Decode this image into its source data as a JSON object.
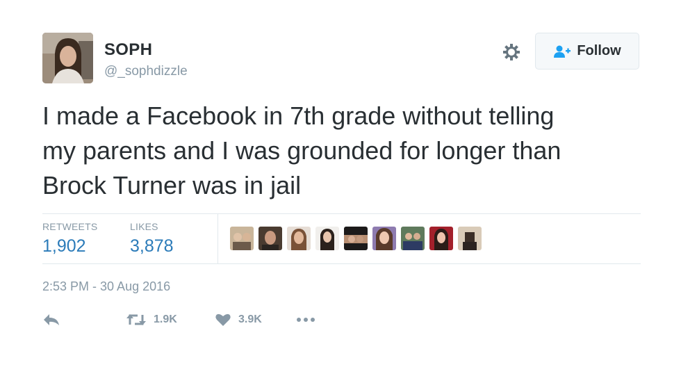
{
  "user": {
    "name": "SOPH",
    "handle": "@_sophdizzle"
  },
  "follow": {
    "label": "Follow"
  },
  "tweet": {
    "lines": [
      "I made a Facebook in 7th grade without telling",
      "my parents and I was grounded for longer than",
      "Brock Turner was in jail"
    ]
  },
  "stats": {
    "retweets_label": "RETWEETS",
    "retweets_value": "1,902",
    "likes_label": "LIKES",
    "likes_value": "3,878"
  },
  "timestamp": "2:53 PM - 30 Aug 2016",
  "actions": {
    "retweet_count": "1.9K",
    "like_count": "3.9K"
  },
  "colors": {
    "link": "#2b7bb9",
    "muted": "#8899a6",
    "text": "#292f33"
  },
  "icons": [
    "gear-icon",
    "add-user-icon",
    "reply-icon",
    "retweet-icon",
    "heart-icon",
    "more-icon"
  ]
}
